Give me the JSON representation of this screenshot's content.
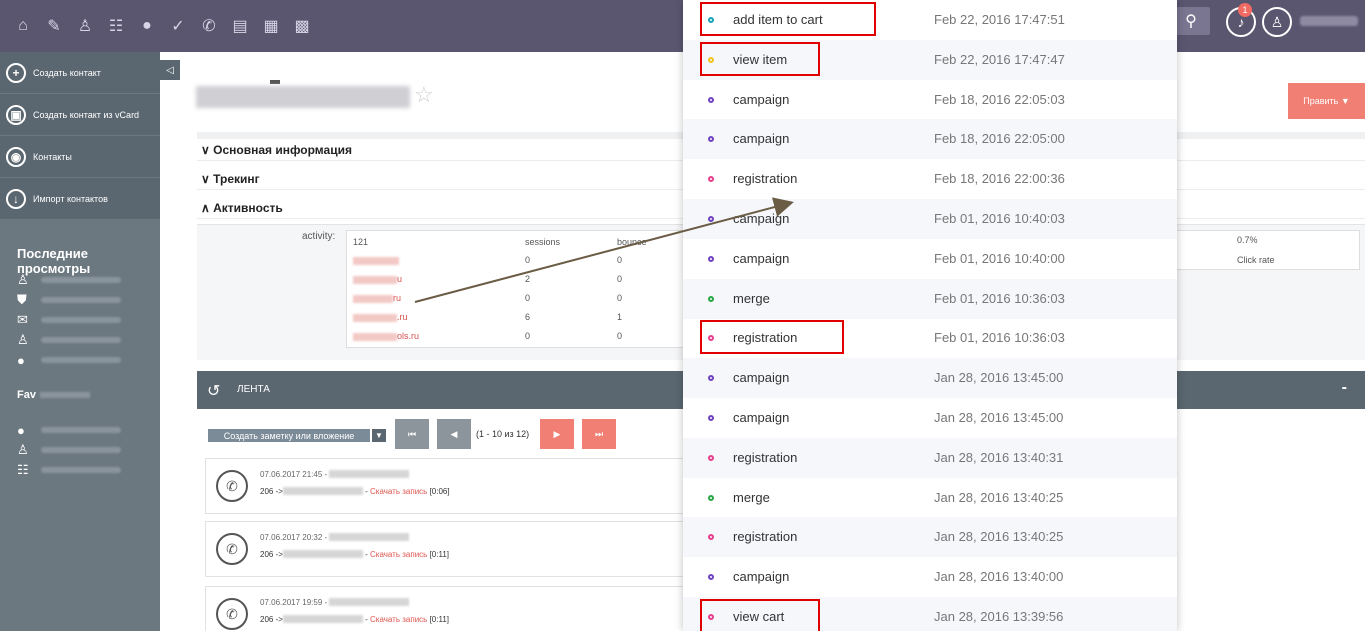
{
  "topbar": {
    "icons": [
      "home-icon",
      "edit-icon",
      "user-icon",
      "users-icon",
      "bulb-icon",
      "check-icon",
      "phone-icon",
      "book-icon",
      "calendar-icon",
      "grid-icon"
    ],
    "notification_count": "1"
  },
  "sidebar": {
    "items": [
      {
        "label": "Создать контакт",
        "icon": "+"
      },
      {
        "label": "Создать контакт из vCard",
        "icon": "▣"
      },
      {
        "label": "Контакты",
        "icon": "◉"
      },
      {
        "label": "Импорт контактов",
        "icon": "↓"
      }
    ],
    "recent_title": "Последние просмотры",
    "favorites_title": "Fav"
  },
  "main": {
    "edit_label": "Править ▼",
    "sections": [
      {
        "label": "∨ Основная информация"
      },
      {
        "label": "∨ Трекинг"
      },
      {
        "label": "∧ Активность"
      }
    ],
    "activity": {
      "label": "activity:",
      "total": "121",
      "col_sessions": "sessions",
      "col_bounce": "bounce",
      "rows": [
        {
          "domain_suffix": "",
          "sessions": "0",
          "bounce": "0"
        },
        {
          "domain_suffix": "u",
          "sessions": "2",
          "bounce": "0"
        },
        {
          "domain_suffix": "ru",
          "sessions": "0",
          "bounce": "0"
        },
        {
          "domain_suffix": ".ru",
          "sessions": "6",
          "bounce": "1"
        },
        {
          "domain_suffix": "ols.ru",
          "sessions": "0",
          "bounce": "0"
        }
      ],
      "click_rate_value": "0.7%",
      "click_rate_label": "Click rate"
    },
    "feed": {
      "title": "ЛЕНТА",
      "collapse": "-",
      "note_button": "Создать заметку или вложение",
      "page_info": "(1 - 10 из 12)",
      "calls": [
        {
          "time": "07.06.2017 21:45 - ",
          "number": "206 ->",
          "link": "Скачать запись",
          "duration": "[0:06]"
        },
        {
          "time": "07.06.2017 20:32 - ",
          "number": "206 ->",
          "link": "Скачать запись",
          "duration": "[0:11]"
        },
        {
          "time": "07.06.2017 19:59 - ",
          "number": "206 ->",
          "link": "Скачать запись",
          "duration": "[0:11]"
        }
      ]
    }
  },
  "events": [
    {
      "name": "add item to cart",
      "date": "Feb 22, 2016 17:47:51",
      "color": "#17a2b8",
      "highlight": true
    },
    {
      "name": "view item",
      "date": "Feb 22, 2016 17:47:47",
      "color": "#f0c419",
      "highlight": true
    },
    {
      "name": "campaign",
      "date": "Feb 18, 2016 22:05:03",
      "color": "#6f42c1",
      "highlight": false
    },
    {
      "name": "campaign",
      "date": "Feb 18, 2016 22:05:00",
      "color": "#6f42c1",
      "highlight": false
    },
    {
      "name": "registration",
      "date": "Feb 18, 2016 22:00:36",
      "color": "#e83e8c",
      "highlight": false
    },
    {
      "name": "campaign",
      "date": "Feb 01, 2016 10:40:03",
      "color": "#6f42c1",
      "highlight": false
    },
    {
      "name": "campaign",
      "date": "Feb 01, 2016 10:40:00",
      "color": "#6f42c1",
      "highlight": false
    },
    {
      "name": "merge",
      "date": "Feb 01, 2016 10:36:03",
      "color": "#28a745",
      "highlight": false
    },
    {
      "name": "registration",
      "date": "Feb 01, 2016 10:36:03",
      "color": "#e83e8c",
      "highlight": true
    },
    {
      "name": "campaign",
      "date": "Jan 28, 2016 13:45:00",
      "color": "#6f42c1",
      "highlight": false
    },
    {
      "name": "campaign",
      "date": "Jan 28, 2016 13:45:00",
      "color": "#6f42c1",
      "highlight": false
    },
    {
      "name": "registration",
      "date": "Jan 28, 2016 13:40:31",
      "color": "#e83e8c",
      "highlight": false
    },
    {
      "name": "merge",
      "date": "Jan 28, 2016 13:40:25",
      "color": "#28a745",
      "highlight": false
    },
    {
      "name": "registration",
      "date": "Jan 28, 2016 13:40:25",
      "color": "#e83e8c",
      "highlight": false
    },
    {
      "name": "campaign",
      "date": "Jan 28, 2016 13:40:00",
      "color": "#6f42c1",
      "highlight": false
    },
    {
      "name": "view cart",
      "date": "Jan 28, 2016 13:39:56",
      "color": "#e83e8c",
      "highlight": true
    }
  ]
}
